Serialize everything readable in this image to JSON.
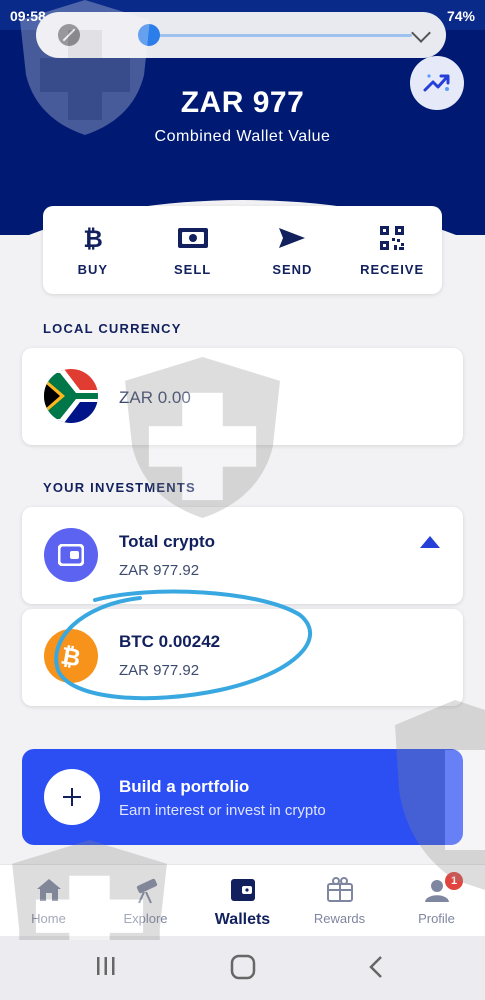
{
  "status_bar": {
    "time": "09:58",
    "battery": "74%"
  },
  "header": {
    "balance": "ZAR 977",
    "balance_label": "Combined Wallet Value"
  },
  "actions": [
    {
      "label": "BUY",
      "icon": "bitcoin-icon"
    },
    {
      "label": "SELL",
      "icon": "cash-icon"
    },
    {
      "label": "SEND",
      "icon": "send-icon"
    },
    {
      "label": "RECEIVE",
      "icon": "qr-code-icon"
    }
  ],
  "local_currency": {
    "title": "LOCAL CURRENCY",
    "amount": "ZAR 0.00",
    "icon": "south-africa-flag-icon"
  },
  "investments": {
    "title": "YOUR INVESTMENTS",
    "total": {
      "label": "Total crypto",
      "value": "ZAR 977.92",
      "icon": "wallet-icon"
    },
    "btc": {
      "label": "BTC 0.00242",
      "value": "ZAR 977.92",
      "icon": "bitcoin-coin-icon"
    }
  },
  "portfolio": {
    "title": "Build a portfolio",
    "subtitle": "Earn interest or invest in crypto",
    "icon": "plus-icon"
  },
  "bottom_nav": [
    {
      "label": "Home",
      "icon": "home-icon"
    },
    {
      "label": "Explore",
      "icon": "telescope-icon"
    },
    {
      "label": "Wallets",
      "icon": "wallet-icon"
    },
    {
      "label": "Rewards",
      "icon": "gift-icon"
    },
    {
      "label": "Profile",
      "icon": "profile-icon",
      "badge": "1"
    }
  ],
  "colors": {
    "header_bg": "#001a73",
    "accent": "#2c4ff3",
    "text_dark": "#12215e",
    "btc_orange": "#f7931a",
    "wallet_purple": "#5b63f0"
  }
}
